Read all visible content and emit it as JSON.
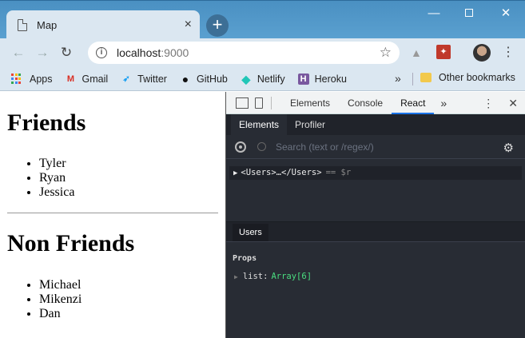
{
  "browser": {
    "tab": {
      "title": "Map",
      "close": "×"
    },
    "new_tab": "+",
    "window_controls": {
      "minimize": "—",
      "close": "✕"
    },
    "url": {
      "host": "localhost",
      "port": ":9000"
    }
  },
  "bookmarks": {
    "items": [
      {
        "label": "Apps",
        "icon": "apps-grid-icon"
      },
      {
        "label": "Gmail",
        "icon": "gmail-icon",
        "glyph": "M",
        "color": "#d93025"
      },
      {
        "label": "Twitter",
        "icon": "twitter-icon",
        "glyph": "🐦",
        "color": "#1da1f2"
      },
      {
        "label": "GitHub",
        "icon": "github-icon",
        "glyph": "●",
        "color": "#111111"
      },
      {
        "label": "Netlify",
        "icon": "netlify-icon",
        "glyph": "◆",
        "color": "#20c6b7"
      },
      {
        "label": "Heroku",
        "icon": "heroku-icon",
        "glyph": "H",
        "color": "#79589f"
      }
    ],
    "more": "»",
    "other": "Other bookmarks"
  },
  "page": {
    "friends_heading": "Friends",
    "friends": [
      "Tyler",
      "Ryan",
      "Jessica"
    ],
    "non_friends_heading": "Non Friends",
    "non_friends": [
      "Michael",
      "Mikenzi",
      "Dan"
    ]
  },
  "devtools": {
    "tabs": [
      "Elements",
      "Console",
      "React"
    ],
    "active_tab": "React",
    "more": "»",
    "react": {
      "tabs": [
        "Elements",
        "Profiler"
      ],
      "search_placeholder": "Search (text or /regex/)",
      "tree_row": {
        "arrow": "▶",
        "label": "<Users>…</Users>",
        "eq": "== $r"
      },
      "selected_component": "Users",
      "props_label": "Props",
      "prop": {
        "arrow": "▶",
        "key": "list:",
        "value": "Array[6]"
      }
    }
  },
  "colors": {
    "react_accent": "#1a73e8",
    "devtools_bg": "#282c34",
    "prop_value": "#4ade80"
  }
}
